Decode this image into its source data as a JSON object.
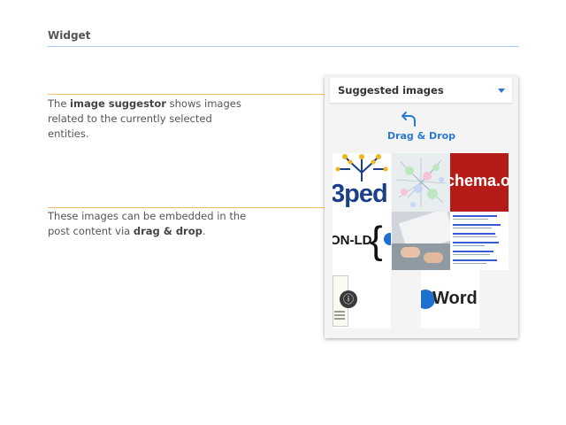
{
  "header": {
    "title": "Widget"
  },
  "captions": [
    {
      "pre": "The ",
      "bold": "image suggestor",
      "post": " shows images related to the currently selected entities."
    },
    {
      "pre": "These images can be embedded in the post content via ",
      "bold": "drag & drop",
      "post": "."
    }
  ],
  "widget": {
    "title": "Suggested images",
    "drag_label": "Drag & Drop",
    "icons": {
      "dropdown": "chevron-down-icon",
      "drag": "undo-arrow-icon"
    },
    "tiles": [
      {
        "name": "dbpedia-logo-image",
        "text": "3ped"
      },
      {
        "name": "network-graph-image",
        "text": ""
      },
      {
        "name": "schema-org-logo-image",
        "text": "chema.o"
      },
      {
        "name": "json-ld-logo-image",
        "text": "ON-LD"
      },
      {
        "name": "typing-laptop-image",
        "text": ""
      },
      {
        "name": "search-results-screenshot-image",
        "text": ""
      },
      {
        "name": "document-diagram-image",
        "text": ""
      },
      {
        "name": "wordpress-logo-image",
        "text": "Word"
      }
    ]
  },
  "colors": {
    "accent_blue": "#2a7ad1",
    "connector_orange": "#f2c36f",
    "header_rule": "#a9cdf2",
    "schema_red": "#b51c17"
  }
}
